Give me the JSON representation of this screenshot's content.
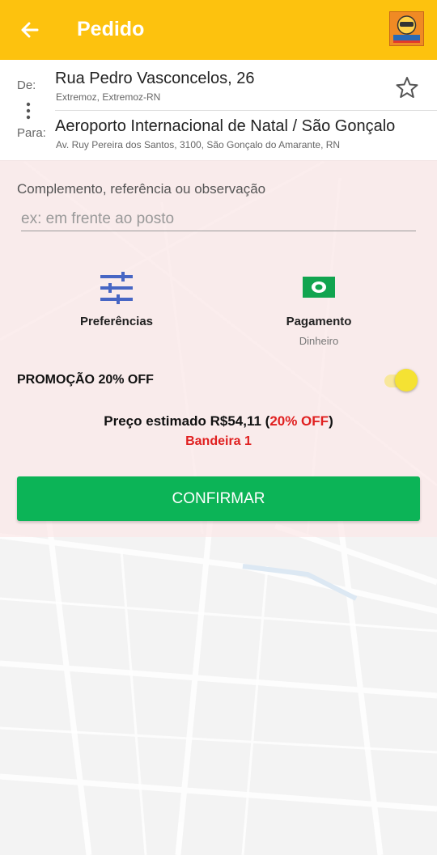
{
  "header": {
    "title": "Pedido",
    "back_icon": "arrow-left-icon",
    "logo": "app-logo",
    "bg_color": "#fdc20e"
  },
  "address": {
    "from_label": "De:",
    "from_main": "Rua Pedro Vasconcelos, 26",
    "from_sub": "Extremoz, Extremoz-RN",
    "to_label": "Para:",
    "to_main": "Aeroporto Internacional de Natal / São Gonçalo",
    "to_sub": "Av. Ruy Pereira dos Santos, 3100, São Gonçalo do Amarante, RN",
    "favorite_icon": "star-outline-icon"
  },
  "form": {
    "complement_label": "Complemento, referência ou observação",
    "complement_placeholder": "ex: em frente ao posto",
    "complement_value": ""
  },
  "options": {
    "preferences": {
      "label": "Preferências",
      "icon": "sliders-icon",
      "icon_color": "#4766c4"
    },
    "payment": {
      "label": "Pagamento",
      "sub": "Dinheiro",
      "icon": "cash-icon",
      "icon_color": "#11a44f"
    }
  },
  "promo": {
    "label": "PROMOÇÃO 20% OFF",
    "enabled": true,
    "toggle_color": "#f5e233"
  },
  "price": {
    "prefix": "Preço estimado R$54,11 (",
    "discount": "20% OFF",
    "suffix": ")",
    "bandeira": "Bandeira 1",
    "highlight_color": "#e01f1f"
  },
  "confirm": {
    "label": "CONFIRMAR",
    "color": "#0cb457"
  }
}
